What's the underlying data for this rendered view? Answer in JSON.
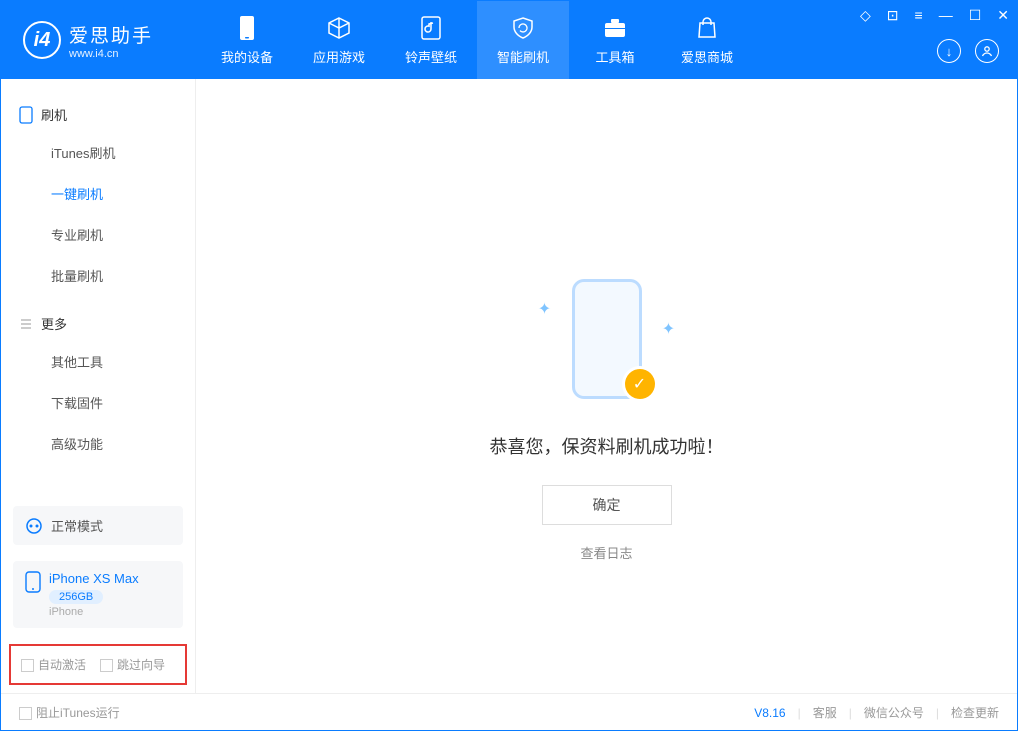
{
  "brand": {
    "title": "爱思助手",
    "subtitle": "www.i4.cn"
  },
  "nav": {
    "my_device": "我的设备",
    "apps_games": "应用游戏",
    "ring_wall": "铃声壁纸",
    "smart_flash": "智能刷机",
    "toolbox": "工具箱",
    "store": "爱思商城"
  },
  "sidebar": {
    "section_flash": "刷机",
    "itunes_flash": "iTunes刷机",
    "one_key_flash": "一键刷机",
    "pro_flash": "专业刷机",
    "batch_flash": "批量刷机",
    "section_more": "更多",
    "other_tools": "其他工具",
    "download_fw": "下载固件",
    "adv_func": "高级功能",
    "mode_normal": "正常模式",
    "device_name": "iPhone XS Max",
    "device_capacity": "256GB",
    "device_type": "iPhone",
    "auto_activate": "自动激活",
    "skip_guide": "跳过向导"
  },
  "main": {
    "success_msg": "恭喜您，保资料刷机成功啦！",
    "ok_btn": "确定",
    "log_link": "查看日志"
  },
  "footer": {
    "block_itunes": "阻止iTunes运行",
    "version": "V8.16",
    "service": "客服",
    "wechat": "微信公众号",
    "update": "检查更新"
  }
}
